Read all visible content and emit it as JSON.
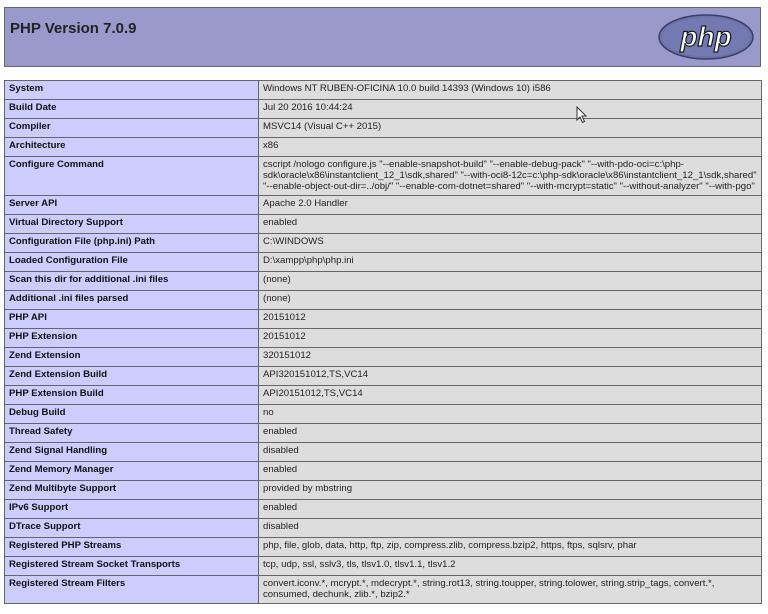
{
  "header": {
    "title": "PHP Version 7.0.9",
    "logo_text": "php"
  },
  "rows": [
    {
      "label": "System",
      "value": "Windows NT RUBEN-OFICINA 10.0 build 14393 (Windows 10) i586"
    },
    {
      "label": "Build Date",
      "value": "Jul 20 2016 10:44:24"
    },
    {
      "label": "Compiler",
      "value": "MSVC14 (Visual C++ 2015)"
    },
    {
      "label": "Architecture",
      "value": "x86"
    },
    {
      "label": "Configure Command",
      "value": "cscript /nologo configure.js \"--enable-snapshot-build\" \"--enable-debug-pack\" \"--with-pdo-oci=c:\\php-sdk\\oracle\\x86\\instantclient_12_1\\sdk,shared\" \"--with-oci8-12c=c:\\php-sdk\\oracle\\x86\\instantclient_12_1\\sdk,shared\" \"--enable-object-out-dir=../obj/\" \"--enable-com-dotnet=shared\" \"--with-mcrypt=static\" \"--without-analyzer\" \"--with-pgo\""
    },
    {
      "label": "Server API",
      "value": "Apache 2.0 Handler"
    },
    {
      "label": "Virtual Directory Support",
      "value": "enabled"
    },
    {
      "label": "Configuration File (php.ini) Path",
      "value": "C:\\WINDOWS"
    },
    {
      "label": "Loaded Configuration File",
      "value": "D:\\xampp\\php\\php.ini"
    },
    {
      "label": "Scan this dir for additional .ini files",
      "value": "(none)"
    },
    {
      "label": "Additional .ini files parsed",
      "value": "(none)"
    },
    {
      "label": "PHP API",
      "value": "20151012"
    },
    {
      "label": "PHP Extension",
      "value": "20151012"
    },
    {
      "label": "Zend Extension",
      "value": "320151012"
    },
    {
      "label": "Zend Extension Build",
      "value": "API320151012,TS,VC14"
    },
    {
      "label": "PHP Extension Build",
      "value": "API20151012,TS,VC14"
    },
    {
      "label": "Debug Build",
      "value": "no"
    },
    {
      "label": "Thread Safety",
      "value": "enabled"
    },
    {
      "label": "Zend Signal Handling",
      "value": "disabled"
    },
    {
      "label": "Zend Memory Manager",
      "value": "enabled"
    },
    {
      "label": "Zend Multibyte Support",
      "value": "provided by mbstring"
    },
    {
      "label": "IPv6 Support",
      "value": "enabled"
    },
    {
      "label": "DTrace Support",
      "value": "disabled"
    },
    {
      "label": "Registered PHP Streams",
      "value": "php, file, glob, data, http, ftp, zip, compress.zlib, compress.bzip2, https, ftps, sqlsrv, phar"
    },
    {
      "label": "Registered Stream Socket Transports",
      "value": "tcp, udp, ssl, sslv3, tls, tlsv1.0, tlsv1.1, tlsv1.2"
    },
    {
      "label": "Registered Stream Filters",
      "value": "convert.iconv.*, mcrypt.*, mdecrypt.*, string.rot13, string.toupper, string.tolower, string.strip_tags, convert.*, consumed, dechunk, zlib.*, bzip2.*"
    }
  ]
}
